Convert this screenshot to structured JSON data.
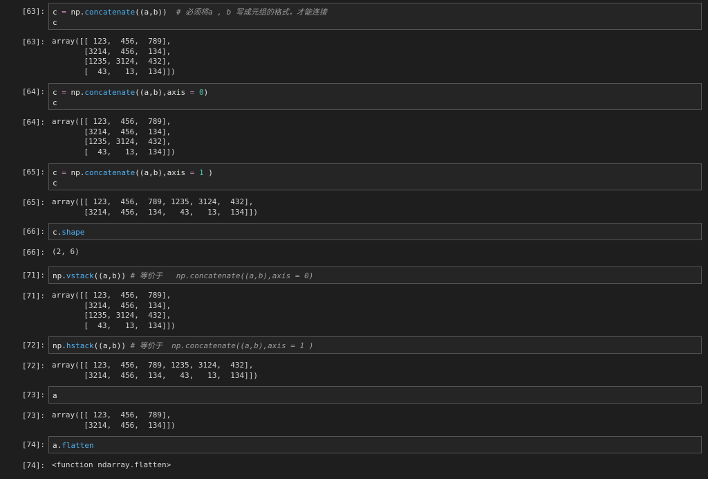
{
  "cells": [
    {
      "in_prompt": "[63]:",
      "code_lines": [
        [
          {
            "t": "c "
          },
          {
            "t": "=",
            "c": "op"
          },
          {
            "t": " np."
          },
          {
            "t": "concatenate",
            "c": "fn"
          },
          {
            "t": "((a,b))  "
          },
          {
            "t": "# 必须将a , b 写成元组的格式，才能连接",
            "c": "cm"
          }
        ],
        [
          {
            "t": "c"
          }
        ]
      ],
      "out_prompt": "[63]:",
      "output_lines": [
        "array([[ 123,  456,  789],",
        "       [3214,  456,  134],",
        "       [1235, 3124,  432],",
        "       [  43,   13,  134]])"
      ]
    },
    {
      "in_prompt": "[64]:",
      "code_lines": [
        [
          {
            "t": "c "
          },
          {
            "t": "=",
            "c": "op"
          },
          {
            "t": " np."
          },
          {
            "t": "concatenate",
            "c": "fn"
          },
          {
            "t": "((a,b),axis "
          },
          {
            "t": "=",
            "c": "op"
          },
          {
            "t": " "
          },
          {
            "t": "0",
            "c": "num"
          },
          {
            "t": ")"
          }
        ],
        [
          {
            "t": "c"
          }
        ]
      ],
      "out_prompt": "[64]:",
      "output_lines": [
        "array([[ 123,  456,  789],",
        "       [3214,  456,  134],",
        "       [1235, 3124,  432],",
        "       [  43,   13,  134]])"
      ]
    },
    {
      "in_prompt": "[65]:",
      "code_lines": [
        [
          {
            "t": "c "
          },
          {
            "t": "=",
            "c": "op"
          },
          {
            "t": " np."
          },
          {
            "t": "concatenate",
            "c": "fn"
          },
          {
            "t": "((a,b),axis "
          },
          {
            "t": "=",
            "c": "op"
          },
          {
            "t": " "
          },
          {
            "t": "1",
            "c": "num"
          },
          {
            "t": " )"
          }
        ],
        [
          {
            "t": "c"
          }
        ]
      ],
      "out_prompt": "[65]:",
      "output_lines": [
        "array([[ 123,  456,  789, 1235, 3124,  432],",
        "       [3214,  456,  134,   43,   13,  134]])"
      ]
    },
    {
      "in_prompt": "[66]:",
      "code_lines": [
        [
          {
            "t": "c."
          },
          {
            "t": "shape",
            "c": "fn"
          }
        ]
      ],
      "out_prompt": "[66]:",
      "output_lines": [
        "(2, 6)"
      ]
    },
    {
      "in_prompt": "[71]:",
      "code_lines": [
        [
          {
            "t": "np."
          },
          {
            "t": "vstack",
            "c": "fn"
          },
          {
            "t": "((a,b)) "
          },
          {
            "t": "# 等价于   np.concatenate((a,b),axis = 0)",
            "c": "cm"
          }
        ]
      ],
      "out_prompt": "[71]:",
      "output_lines": [
        "array([[ 123,  456,  789],",
        "       [3214,  456,  134],",
        "       [1235, 3124,  432],",
        "       [  43,   13,  134]])"
      ]
    },
    {
      "in_prompt": "[72]:",
      "code_lines": [
        [
          {
            "t": "np."
          },
          {
            "t": "hstack",
            "c": "fn"
          },
          {
            "t": "((a,b)) "
          },
          {
            "t": "# 等价于  np.concatenate((a,b),axis = 1 )",
            "c": "cm"
          }
        ]
      ],
      "out_prompt": "[72]:",
      "output_lines": [
        "array([[ 123,  456,  789, 1235, 3124,  432],",
        "       [3214,  456,  134,   43,   13,  134]])"
      ]
    },
    {
      "in_prompt": "[73]:",
      "code_lines": [
        [
          {
            "t": "a"
          }
        ]
      ],
      "out_prompt": "[73]:",
      "output_lines": [
        "array([[ 123,  456,  789],",
        "       [3214,  456,  134]])"
      ]
    },
    {
      "in_prompt": "[74]:",
      "code_lines": [
        [
          {
            "t": "a."
          },
          {
            "t": "flatten",
            "c": "fn"
          }
        ]
      ],
      "out_prompt": "[74]:",
      "output_lines": [
        "<function ndarray.flatten>"
      ]
    }
  ],
  "theme": {
    "background": "#1e1e1e",
    "code_background": "#252526",
    "border": "#555555",
    "keyword_color": "#4fb1f0",
    "operator_color": "#c586c0",
    "number_color": "#4ec9b0",
    "comment_color": "#9e9e9e"
  }
}
